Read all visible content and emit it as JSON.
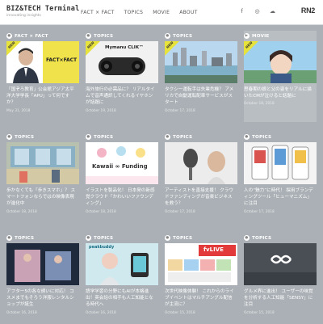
{
  "header": {
    "logo": "BIZ&TECH Terminal",
    "tagline": "innovating insights",
    "nav": [
      "FACT × FACT",
      "TOPICS",
      "MOVIE",
      "ABOUT"
    ],
    "brand": "RN2"
  },
  "cards": [
    {
      "tag": "FACT × FACT",
      "title": "「国ぞろ教育」公会館アジア太平洋大学学長「APU」って何ですか？",
      "date": "May 31, 2018",
      "is_new": true
    },
    {
      "tag": "TOPICS",
      "title": "海外旅行の必需品に？ リアルタイムで音声通訳してくれるイヤホンが話題に",
      "date": "October 19, 2018",
      "is_new": true
    },
    {
      "tag": "TOPICS",
      "title": "タクシー運転手は失業危機？ アメリカで自動運転配車サービスがスタート",
      "date": "October 17, 2018",
      "is_new": true
    },
    {
      "tag": "MOVIE",
      "title": "思春期の娘と父の姿をリアルに描いたCMが泣けると話題に",
      "date": "October 18, 2018",
      "is_new": true
    },
    {
      "tag": "TOPICS",
      "title": "歩かなくても「歩きスマホ」？ スマートフォンならではの映像表現が進化中",
      "date": "October 18, 2018",
      "is_new": false
    },
    {
      "tag": "TOPICS",
      "title": "イラストを製品化！ 日本発の新感覚クラウド「かわいいファウンディング」",
      "date": "October 18, 2018",
      "is_new": false
    },
    {
      "tag": "TOPICS",
      "title": "アーティストを直接支援！ クラウドファンディングが音楽ビジネスを救う？",
      "date": "October 17, 2018",
      "is_new": false
    },
    {
      "tag": "TOPICS",
      "title": "人の“魅力”に時代！ 採用ブランディングツール「ヒューマニズム」に注目",
      "date": "October 17, 2018",
      "is_new": false
    },
    {
      "tag": "TOPICS",
      "title": "アフター5の各な誘いに対応！ コスメまでもそろう洋服レンタルショップが誕生",
      "date": "October 16, 2018",
      "is_new": false
    },
    {
      "tag": "TOPICS",
      "title": "語学学習の分野にもAIが本格進出！英会話の相手も人工知能となる時代へ",
      "date": "October 16, 2018",
      "is_new": false
    },
    {
      "tag": "TOPICS",
      "title": "次世代映像体験！ これからのライブイベントはマルチアングル配信が主流に？",
      "date": "October 15, 2018",
      "is_new": false
    },
    {
      "tag": "TOPICS",
      "title": "グルメ界に進出！ ユーザーの味覚を分析する人工知能「SENSY」に注目",
      "date": "October 15, 2018",
      "is_new": false
    }
  ],
  "thumb_text": {
    "fact": "FACT×FACT",
    "earbuds": "Mymanu CLIK™",
    "kawaii": "Kawaii ∞ Funding",
    "peak": "peakbuddy",
    "live": "fvLIVE"
  },
  "new_label": "NEW",
  "colors": {
    "accent": "#e8e33a",
    "background": "#aab0b5"
  }
}
